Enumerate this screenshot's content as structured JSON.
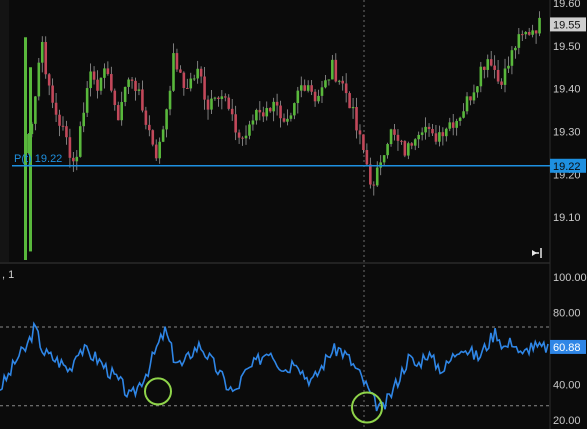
{
  "chart_data": [
    {
      "type": "candlestick",
      "panel": "price",
      "y_axis_ticks": [
        "19.60",
        "19.50",
        "19.40",
        "19.30",
        "19.20",
        "19.10"
      ],
      "ylim": [
        19.0,
        19.6
      ],
      "current_price_label": "19.55",
      "current_price": 19.55,
      "horizontal_line": {
        "label": "P(t) 19.22",
        "value": 19.22,
        "axis_label": "19.22"
      },
      "colors": {
        "up": "#59b83c",
        "down": "#c2485a",
        "line": "#1e90e0"
      },
      "close_path": [
        19.25,
        19.35,
        19.52,
        19.38,
        19.33,
        19.28,
        19.22,
        19.35,
        19.45,
        19.4,
        19.45,
        19.32,
        19.4,
        19.43,
        19.36,
        19.3,
        19.24,
        19.35,
        19.48,
        19.4,
        19.42,
        19.44,
        19.36,
        19.4,
        19.38,
        19.32,
        19.28,
        19.3,
        19.36,
        19.34,
        19.38,
        19.3,
        19.32,
        19.4,
        19.42,
        19.38,
        19.4,
        19.45,
        19.42,
        19.38,
        19.3,
        19.24,
        19.16,
        19.25,
        19.3,
        19.27,
        19.25,
        19.3,
        19.32,
        19.28,
        19.3,
        19.32,
        19.33,
        19.36,
        19.4,
        19.45,
        19.48,
        19.42,
        19.44,
        19.5,
        19.52,
        19.54,
        19.55
      ]
    },
    {
      "type": "line",
      "panel": "oscillator",
      "header": ", 1",
      "y_axis_ticks": [
        "100.00",
        "80.00",
        "40.00",
        "20.00"
      ],
      "ylim": [
        20,
        100
      ],
      "reference_lines": [
        72,
        28
      ],
      "current_value_label": "60.88",
      "current_value": 60.88,
      "colors": {
        "line": "#2f86e6",
        "marker": "#8fd44a"
      },
      "values": [
        38,
        45,
        55,
        60,
        72,
        58,
        55,
        52,
        48,
        60,
        58,
        55,
        50,
        45,
        40,
        32,
        40,
        48,
        60,
        70,
        55,
        50,
        58,
        62,
        55,
        48,
        40,
        35,
        45,
        50,
        55,
        60,
        52,
        48,
        55,
        45,
        42,
        50,
        58,
        60,
        55,
        48,
        40,
        30,
        26,
        35,
        45,
        55,
        50,
        58,
        52,
        48,
        55,
        62,
        58,
        55,
        62,
        70,
        60,
        65,
        55,
        62,
        60,
        61
      ]
    }
  ]
}
